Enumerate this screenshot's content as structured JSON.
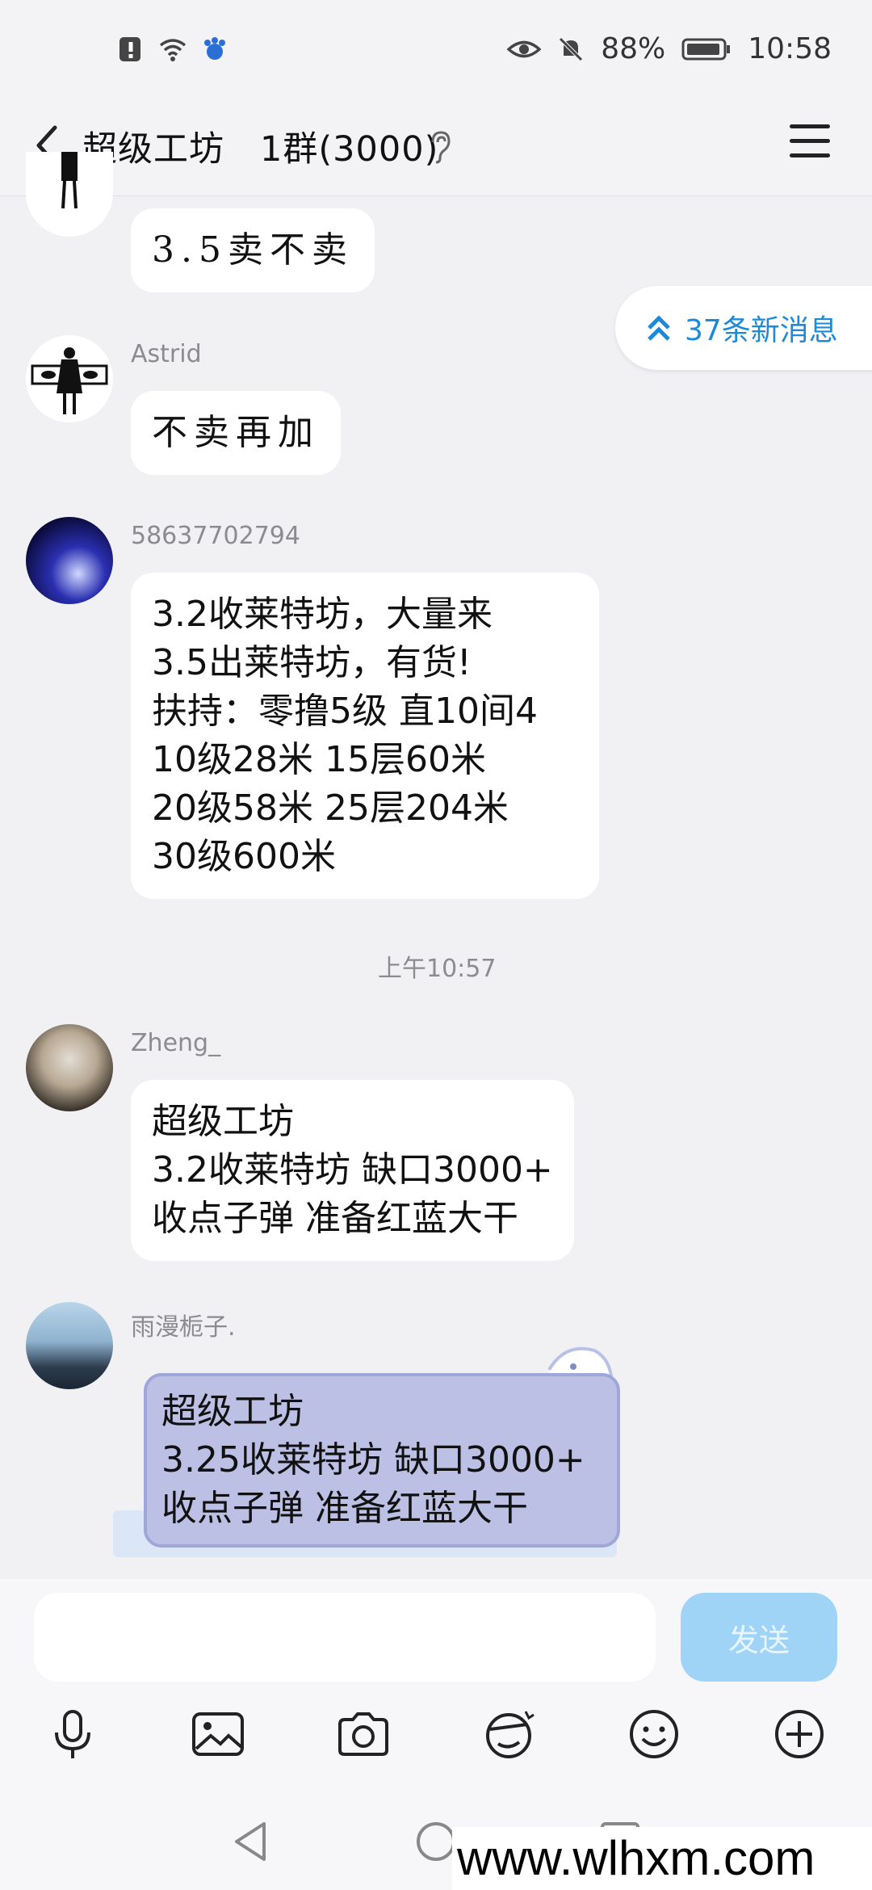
{
  "status": {
    "battery": "88%",
    "time": "10:58"
  },
  "header": {
    "title": "超级工坊   1群(3000)"
  },
  "new_messages": "37条新消息",
  "messages": [
    {
      "sender": "",
      "text": "3.5卖不卖"
    },
    {
      "sender": "Astrid",
      "text": "不卖再加"
    },
    {
      "sender": "58637702794",
      "text": "3.2收莱特坊，大量来\n3.5出莱特坊，有货!\n扶持：零撸5级      直10间4\n10级28米    15层60米\n20级58米   25层204米\n30级600米"
    },
    {
      "sender": "Zheng_",
      "text": "超级工坊\n3.2收莱特坊 缺口3000+\n收点子弹 准备红蓝大干"
    },
    {
      "sender": "雨漫栀子.",
      "text": "超级工坊\n3.25收莱特坊 缺口3000+\n收点子弹 准备红蓝大干"
    }
  ],
  "time_divider": "上午10:57",
  "input": {
    "value": "",
    "send_label": "发送"
  },
  "watermark": "www.wlhxm.com",
  "colors": {
    "accent": "#1c8ad8",
    "send_disabled": "#9fd4f7",
    "background": "#f1f1f4"
  }
}
